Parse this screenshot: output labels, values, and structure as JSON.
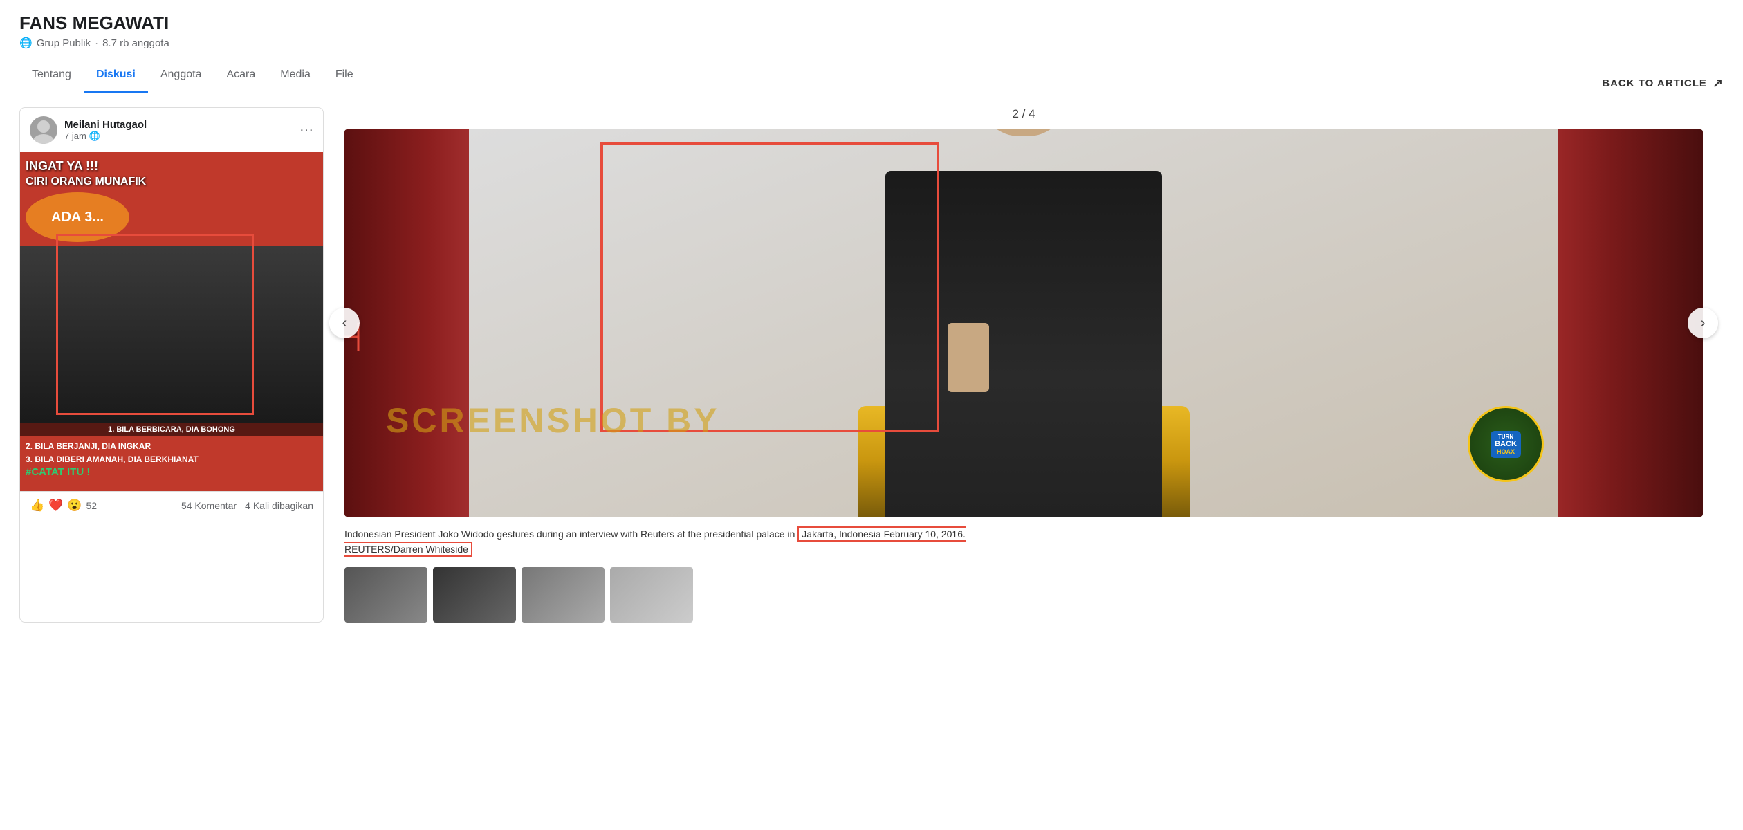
{
  "page": {
    "group_name": "FANS MEGAWATI",
    "group_type": "Grup Publik",
    "group_members": "8.7 rb anggota"
  },
  "nav": {
    "tabs": [
      {
        "label": "Tentang",
        "active": false
      },
      {
        "label": "Diskusi",
        "active": true
      },
      {
        "label": "Anggota",
        "active": false
      },
      {
        "label": "Acara",
        "active": false
      },
      {
        "label": "Media",
        "active": false
      },
      {
        "label": "File",
        "active": false
      }
    ]
  },
  "post": {
    "author": "Meilani Hutagaol",
    "time": "7 jam",
    "meme_lines": [
      "INGAT YA !!!",
      "CIRI ORANG MUNAFIK",
      "ADA 3...",
      "1. BILA BERBICARA, DIA BOHONG",
      "2. BILA BERJANJI, DIA INGKAR",
      "3. BILA DIBERI AMANAH, DIA BERKHIANAT",
      "#CATAT ITU !"
    ],
    "reactions_count": "52",
    "comments": "54 Komentar",
    "shares": "4 Kali dibagikan"
  },
  "viewer": {
    "counter": "2 / 4",
    "caption_text": "Indonesian President Joko Widodo gestures during an interview with Reuters at the presidential palace in",
    "caption_highlight": "Jakarta, Indonesia February 10, 2016. REUTERS/Darren Whiteside",
    "watermark": "SCREENSHOT BY",
    "back_label": "BACK TO ARTICLE"
  }
}
